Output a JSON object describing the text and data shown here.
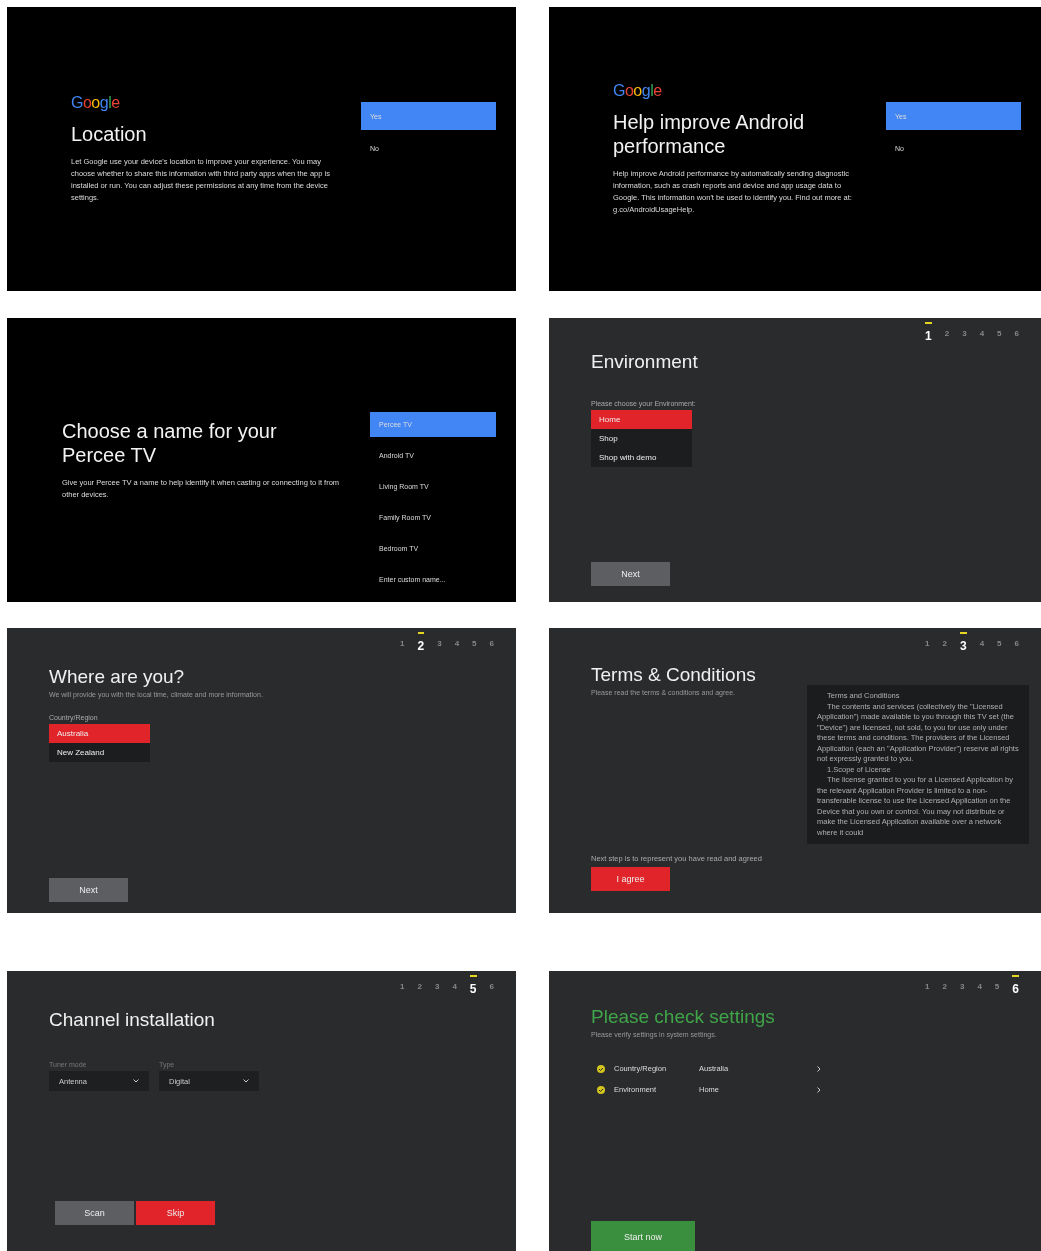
{
  "panels": [
    {
      "kind": "google_choice",
      "logo": "Google",
      "title": "Location",
      "body": "Let Google use your device's location to improve your experience. You may choose whether to share this information with third party apps when the app is installed or run. You can adjust these permissions at any time from the device settings.",
      "options": [
        {
          "label": "Yes",
          "selected": true
        },
        {
          "label": "No",
          "selected": false
        }
      ]
    },
    {
      "kind": "google_choice",
      "logo": "Google",
      "title": "Help improve Android performance",
      "body": "Help improve Android performance by automatically sending diagnostic information, such as crash reports and device and app usage data to Google. This information won't be used to identify you. Find out more at: g.co/AndroidUsageHelp.",
      "options": [
        {
          "label": "Yes",
          "selected": true
        },
        {
          "label": "No",
          "selected": false
        }
      ]
    },
    {
      "kind": "name_choice",
      "title": "Choose a name for your Percee TV",
      "body": "Give your Percee TV a name to help identify it when casting or connecting to it from other devices.",
      "options": [
        {
          "label": "Percee TV",
          "selected": true
        },
        {
          "label": "Android TV",
          "selected": false
        },
        {
          "label": "Living Room TV",
          "selected": false
        },
        {
          "label": "Family Room TV",
          "selected": false
        },
        {
          "label": "Bedroom TV",
          "selected": false
        },
        {
          "label": "Enter custom name...",
          "selected": false
        }
      ]
    },
    {
      "kind": "list_step",
      "steps": [
        {
          "label": "1",
          "selected": true
        },
        {
          "label": "2",
          "selected": false
        },
        {
          "label": "3",
          "selected": false
        },
        {
          "label": "4",
          "selected": false
        },
        {
          "label": "5",
          "selected": false
        },
        {
          "label": "6",
          "selected": false
        }
      ],
      "title": "Environment",
      "prompt": "Please choose your Environment:",
      "options": [
        {
          "label": "Home",
          "selected": true
        },
        {
          "label": "Shop",
          "selected": false
        },
        {
          "label": "Shop with demo",
          "selected": false
        }
      ],
      "button": "Next"
    },
    {
      "kind": "list_step",
      "steps": [
        {
          "label": "1",
          "selected": false
        },
        {
          "label": "2",
          "selected": true
        },
        {
          "label": "3",
          "selected": false
        },
        {
          "label": "4",
          "selected": false
        },
        {
          "label": "5",
          "selected": false
        },
        {
          "label": "6",
          "selected": false
        }
      ],
      "title": "Where are you?",
      "subtitle": "We will provide you with the local time, climate and more information.",
      "prompt": "Country/Region",
      "options": [
        {
          "label": "Australia",
          "selected": true
        },
        {
          "label": "New Zealand",
          "selected": false
        }
      ],
      "button": "Next"
    },
    {
      "kind": "terms",
      "steps": [
        {
          "label": "1",
          "selected": false
        },
        {
          "label": "2",
          "selected": false
        },
        {
          "label": "3",
          "selected": true
        },
        {
          "label": "4",
          "selected": false
        },
        {
          "label": "5",
          "selected": false
        },
        {
          "label": "6",
          "selected": false
        }
      ],
      "title": "Terms & Conditions",
      "subtitle": "Please read the terms & conditions and agree.",
      "terms": [
        "Terms and Conditions",
        "The contents and services (collectively the \"Licensed Application\") made available to you through this TV set (the \"Device\") are licensed, not sold, to you for use only under these terms and conditions. The providers of the Licensed Application (each an \"Application Provider\") reserve all rights not expressly granted to you.",
        "1.Scope of License",
        "The license granted to you for a Licensed Application by the relevant Application Provider is limited to a non-transferable license to use the Licensed Application on the Device that you own or control. You may not distribute or make the Licensed Application available over a network where it could"
      ],
      "footnote": "Next step is to represent you have read and agreed",
      "button": "I agree"
    },
    {
      "kind": "channel",
      "steps": [
        {
          "label": "1",
          "selected": false
        },
        {
          "label": "2",
          "selected": false
        },
        {
          "label": "3",
          "selected": false
        },
        {
          "label": "4",
          "selected": false
        },
        {
          "label": "5",
          "selected": true
        },
        {
          "label": "6",
          "selected": false
        }
      ],
      "title": "Channel installation",
      "fields": [
        {
          "label": "Tuner mode",
          "value": "Antenna"
        },
        {
          "label": "Type",
          "value": "Digital"
        }
      ],
      "buttons": [
        {
          "label": "Scan",
          "kind": "secondary"
        },
        {
          "label": "Skip",
          "kind": "primary"
        }
      ]
    },
    {
      "kind": "check",
      "steps": [
        {
          "label": "1",
          "selected": false
        },
        {
          "label": "2",
          "selected": false
        },
        {
          "label": "3",
          "selected": false
        },
        {
          "label": "4",
          "selected": false
        },
        {
          "label": "5",
          "selected": false
        },
        {
          "label": "6",
          "selected": true
        }
      ],
      "title": "Please check settings",
      "subtitle": "Please verify settings in system settings.",
      "settings": [
        {
          "label": "Country/Region",
          "value": "Australia",
          "checked": true
        },
        {
          "label": "Environment",
          "value": "Home",
          "checked": true
        }
      ],
      "button": "Start now"
    }
  ]
}
